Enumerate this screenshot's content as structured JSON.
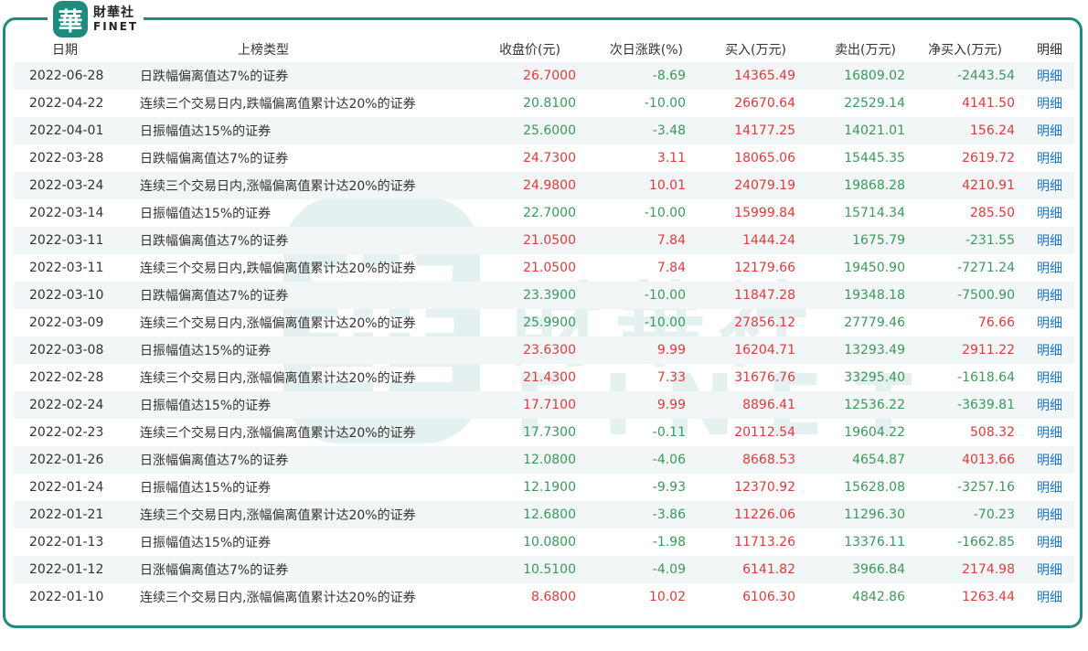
{
  "brand": {
    "badge_char": "華",
    "cn": "財華社",
    "en": "FINET"
  },
  "colors": {
    "frame": "#1f8a7d",
    "up": "#e03b3b",
    "down": "#3a9a5b",
    "link": "#1a77c9",
    "stripe": "#f2f6f7"
  },
  "table": {
    "headers": [
      "日期",
      "上榜类型",
      "收盘价(元)",
      "次日涨跌(%)",
      "买入(万元)",
      "卖出(万元)",
      "净买入(万元)",
      "明细"
    ],
    "detail_label": "明细",
    "rows": [
      {
        "date": "2022-06-28",
        "type": "日跌幅偏离值达7%的证券",
        "close": "26.7000",
        "change": "-8.69",
        "buy": "14365.49",
        "sell": "16809.02",
        "net": "-2443.54",
        "dir": "up"
      },
      {
        "date": "2022-04-22",
        "type": "连续三个交易日内,跌幅偏离值累计达20%的证券",
        "close": "20.8100",
        "change": "-10.00",
        "buy": "26670.64",
        "sell": "22529.14",
        "net": "4141.50",
        "dir": "down"
      },
      {
        "date": "2022-04-01",
        "type": "日振幅值达15%的证券",
        "close": "25.6000",
        "change": "-3.48",
        "buy": "14177.25",
        "sell": "14021.01",
        "net": "156.24",
        "dir": "down"
      },
      {
        "date": "2022-03-28",
        "type": "日跌幅偏离值达7%的证券",
        "close": "24.7300",
        "change": "3.11",
        "buy": "18065.06",
        "sell": "15445.35",
        "net": "2619.72",
        "dir": "up"
      },
      {
        "date": "2022-03-24",
        "type": "连续三个交易日内,涨幅偏离值累计达20%的证券",
        "close": "24.9800",
        "change": "10.01",
        "buy": "24079.19",
        "sell": "19868.28",
        "net": "4210.91",
        "dir": "up"
      },
      {
        "date": "2022-03-14",
        "type": "日振幅值达15%的证券",
        "close": "22.7000",
        "change": "-10.00",
        "buy": "15999.84",
        "sell": "15714.34",
        "net": "285.50",
        "dir": "down"
      },
      {
        "date": "2022-03-11",
        "type": "日跌幅偏离值达7%的证券",
        "close": "21.0500",
        "change": "7.84",
        "buy": "1444.24",
        "sell": "1675.79",
        "net": "-231.55",
        "dir": "up"
      },
      {
        "date": "2022-03-11",
        "type": "连续三个交易日内,跌幅偏离值累计达20%的证券",
        "close": "21.0500",
        "change": "7.84",
        "buy": "12179.66",
        "sell": "19450.90",
        "net": "-7271.24",
        "dir": "up"
      },
      {
        "date": "2022-03-10",
        "type": "日跌幅偏离值达7%的证券",
        "close": "23.3900",
        "change": "-10.00",
        "buy": "11847.28",
        "sell": "19348.18",
        "net": "-7500.90",
        "dir": "down"
      },
      {
        "date": "2022-03-09",
        "type": "连续三个交易日内,涨幅偏离值累计达20%的证券",
        "close": "25.9900",
        "change": "-10.00",
        "buy": "27856.12",
        "sell": "27779.46",
        "net": "76.66",
        "dir": "down"
      },
      {
        "date": "2022-03-08",
        "type": "日振幅值达15%的证券",
        "close": "23.6300",
        "change": "9.99",
        "buy": "16204.71",
        "sell": "13293.49",
        "net": "2911.22",
        "dir": "up"
      },
      {
        "date": "2022-02-28",
        "type": "连续三个交易日内,涨幅偏离值累计达20%的证券",
        "close": "21.4300",
        "change": "7.33",
        "buy": "31676.76",
        "sell": "33295.40",
        "net": "-1618.64",
        "dir": "up"
      },
      {
        "date": "2022-02-24",
        "type": "日振幅值达15%的证券",
        "close": "17.7100",
        "change": "9.99",
        "buy": "8896.41",
        "sell": "12536.22",
        "net": "-3639.81",
        "dir": "up"
      },
      {
        "date": "2022-02-23",
        "type": "连续三个交易日内,涨幅偏离值累计达20%的证券",
        "close": "17.7300",
        "change": "-0.11",
        "buy": "20112.54",
        "sell": "19604.22",
        "net": "508.32",
        "dir": "down"
      },
      {
        "date": "2022-01-26",
        "type": "日涨幅偏离值达7%的证券",
        "close": "12.0800",
        "change": "-4.06",
        "buy": "8668.53",
        "sell": "4654.87",
        "net": "4013.66",
        "dir": "down"
      },
      {
        "date": "2022-01-24",
        "type": "日振幅值达15%的证券",
        "close": "12.1900",
        "change": "-9.93",
        "buy": "12370.92",
        "sell": "15628.08",
        "net": "-3257.16",
        "dir": "down"
      },
      {
        "date": "2022-01-21",
        "type": "连续三个交易日内,涨幅偏离值累计达20%的证券",
        "close": "12.6800",
        "change": "-3.86",
        "buy": "11226.06",
        "sell": "11296.30",
        "net": "-70.23",
        "dir": "down"
      },
      {
        "date": "2022-01-13",
        "type": "日振幅值达15%的证券",
        "close": "10.0800",
        "change": "-1.98",
        "buy": "11713.26",
        "sell": "13376.11",
        "net": "-1662.85",
        "dir": "down"
      },
      {
        "date": "2022-01-12",
        "type": "日涨幅偏离值达7%的证券",
        "close": "10.5100",
        "change": "-4.09",
        "buy": "6141.82",
        "sell": "3966.84",
        "net": "2174.98",
        "dir": "down"
      },
      {
        "date": "2022-01-10",
        "type": "连续三个交易日内,涨幅偏离值累计达20%的证券",
        "close": "8.6800",
        "change": "10.02",
        "buy": "6106.30",
        "sell": "4842.86",
        "net": "1263.44",
        "dir": "up"
      }
    ]
  }
}
